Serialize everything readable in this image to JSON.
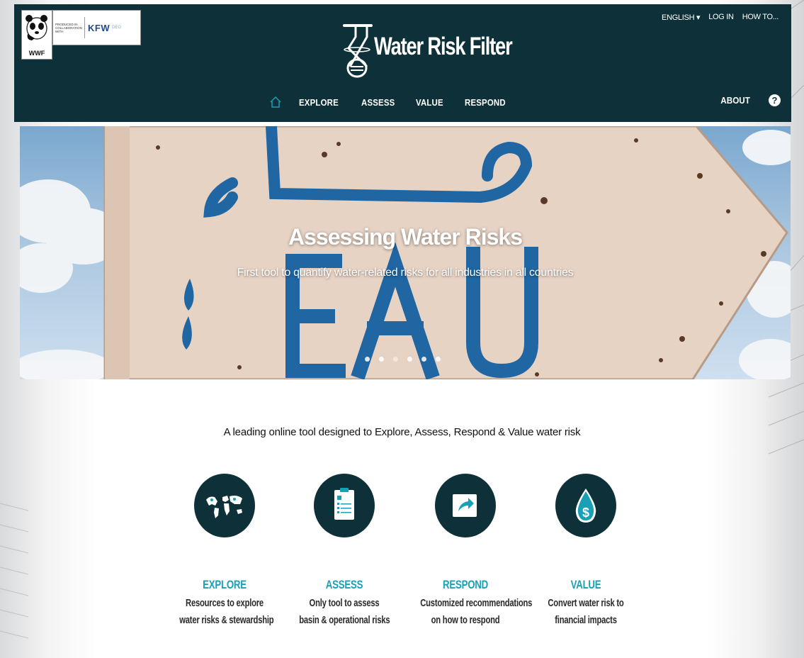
{
  "header": {
    "partner_logo": {
      "wwf_label": "WWF",
      "collab_text": "PRODUCED IN COLLABORATION WITH",
      "kfw_label": "KFW",
      "kfw_sub": "DEG"
    },
    "brand_title": "Water Risk Filter",
    "top_links": [
      "ENGLISH ▾",
      "LOG IN",
      "HOW TO..."
    ]
  },
  "nav": {
    "items": [
      "EXPLORE",
      "ASSESS",
      "VALUE",
      "RESPOND"
    ],
    "about": "ABOUT",
    "help": "?"
  },
  "hero": {
    "title": "Assessing Water Risks",
    "subtitle": "First tool to quantify water-related risks for all industries in all countries",
    "sign_text": "EAU",
    "slide_count": 6,
    "active_slide": 3
  },
  "main": {
    "tagline": "A leading online tool designed to Explore, Assess, Respond & Value water risk",
    "features": [
      {
        "icon": "world-map-icon",
        "title": "EXPLORE",
        "desc_line1": "Resources to explore",
        "desc_line2": "water risks & stewardship"
      },
      {
        "icon": "clipboard-icon",
        "title": "ASSESS",
        "desc_line1": "Only tool to assess",
        "desc_line2": "basin & operational risks"
      },
      {
        "icon": "share-arrow-icon",
        "title": "RESPOND",
        "desc_line1": "Customized recommendations",
        "desc_line2": "on how to respond"
      },
      {
        "icon": "money-drop-icon",
        "title": "VALUE",
        "desc_line1": "Convert water risk to",
        "desc_line2": "financial impacts"
      }
    ]
  },
  "colors": {
    "header_bg": "#0e3139",
    "accent": "#19a0b5",
    "sign_paint": "#1f66a3"
  }
}
